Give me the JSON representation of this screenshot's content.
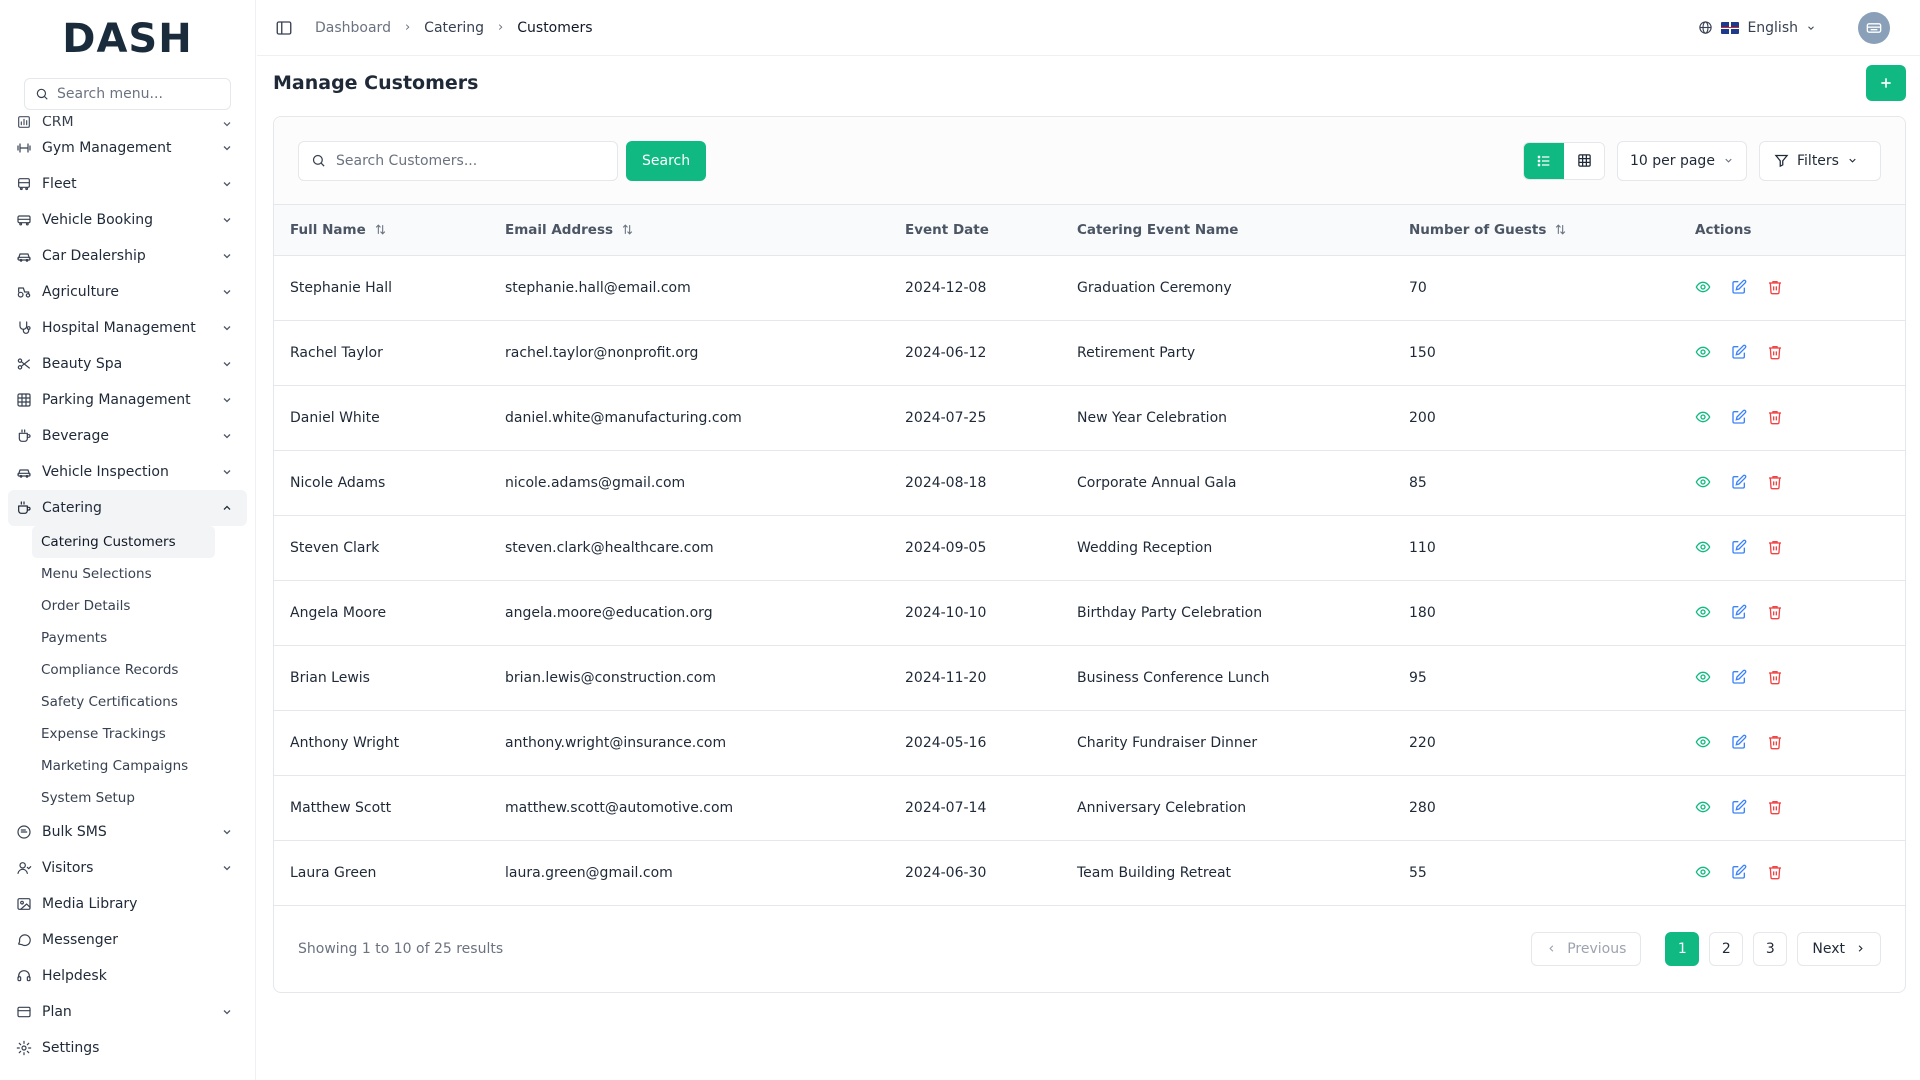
{
  "brand": {
    "logo_text": "DASH"
  },
  "sidebar": {
    "search_placeholder": "Search menu...",
    "cut_item": "CRM",
    "items": [
      {
        "label": "Gym Management",
        "icon": "dumbbell-icon",
        "expandable": true
      },
      {
        "label": "Fleet",
        "icon": "bus-icon",
        "expandable": true
      },
      {
        "label": "Vehicle Booking",
        "icon": "vehicle-icon",
        "expandable": true
      },
      {
        "label": "Car Dealership",
        "icon": "car-icon",
        "expandable": true
      },
      {
        "label": "Agriculture",
        "icon": "tractor-icon",
        "expandable": true
      },
      {
        "label": "Hospital Management",
        "icon": "stethoscope-icon",
        "expandable": true
      },
      {
        "label": "Beauty Spa",
        "icon": "scissors-icon",
        "expandable": true
      },
      {
        "label": "Parking Management",
        "icon": "grid-icon",
        "expandable": true
      },
      {
        "label": "Beverage",
        "icon": "cup-icon",
        "expandable": true
      },
      {
        "label": "Vehicle Inspection",
        "icon": "car-icon",
        "expandable": true
      }
    ],
    "active_item": {
      "label": "Catering",
      "icon": "coffee-icon"
    },
    "sub_items": [
      "Catering Customers",
      "Menu Selections",
      "Order Details",
      "Payments",
      "Compliance Records",
      "Safety Certifications",
      "Expense Trackings",
      "Marketing Campaigns",
      "System Setup"
    ],
    "bottom_items": [
      {
        "label": "Bulk SMS",
        "icon": "message-icon",
        "expandable": true
      },
      {
        "label": "Visitors",
        "icon": "user-icon",
        "expandable": true
      },
      {
        "label": "Media Library",
        "icon": "image-icon",
        "expandable": false
      },
      {
        "label": "Messenger",
        "icon": "chat-icon",
        "expandable": false
      },
      {
        "label": "Helpdesk",
        "icon": "headset-icon",
        "expandable": false
      },
      {
        "label": "Plan",
        "icon": "card-icon",
        "expandable": true
      },
      {
        "label": "Settings",
        "icon": "gear-icon",
        "expandable": false
      }
    ]
  },
  "header": {
    "breadcrumbs": [
      "Dashboard",
      "Catering",
      "Customers"
    ],
    "language": "English"
  },
  "page": {
    "title": "Manage Customers",
    "search_placeholder": "Search Customers...",
    "search_button": "Search",
    "per_page": "10 per page",
    "filters": "Filters"
  },
  "table": {
    "columns": [
      "Full Name",
      "Email Address",
      "Event Date",
      "Catering Event Name",
      "Number of Guests",
      "Actions"
    ],
    "rows": [
      [
        "Stephanie Hall",
        "stephanie.hall@email.com",
        "2024-12-08",
        "Graduation Ceremony",
        "70"
      ],
      [
        "Rachel Taylor",
        "rachel.taylor@nonprofit.org",
        "2024-06-12",
        "Retirement Party",
        "150"
      ],
      [
        "Daniel White",
        "daniel.white@manufacturing.com",
        "2024-07-25",
        "New Year Celebration",
        "200"
      ],
      [
        "Nicole Adams",
        "nicole.adams@gmail.com",
        "2024-08-18",
        "Corporate Annual Gala",
        "85"
      ],
      [
        "Steven Clark",
        "steven.clark@healthcare.com",
        "2024-09-05",
        "Wedding Reception",
        "110"
      ],
      [
        "Angela Moore",
        "angela.moore@education.org",
        "2024-10-10",
        "Birthday Party Celebration",
        "180"
      ],
      [
        "Brian Lewis",
        "brian.lewis@construction.com",
        "2024-11-20",
        "Business Conference Lunch",
        "95"
      ],
      [
        "Anthony Wright",
        "anthony.wright@insurance.com",
        "2024-05-16",
        "Charity Fundraiser Dinner",
        "220"
      ],
      [
        "Matthew Scott",
        "matthew.scott@automotive.com",
        "2024-07-14",
        "Anniversary Celebration",
        "280"
      ],
      [
        "Laura Green",
        "laura.green@gmail.com",
        "2024-06-30",
        "Team Building Retreat",
        "55"
      ]
    ]
  },
  "pagination": {
    "summary": "Showing 1 to 10 of 25 results",
    "previous": "Previous",
    "next": "Next",
    "pages": [
      "1",
      "2",
      "3"
    ],
    "current": "1"
  },
  "colors": {
    "accent": "#10b981",
    "view_icon": "#10b981",
    "edit_icon": "#3b82f6",
    "delete_icon": "#ef4444"
  }
}
